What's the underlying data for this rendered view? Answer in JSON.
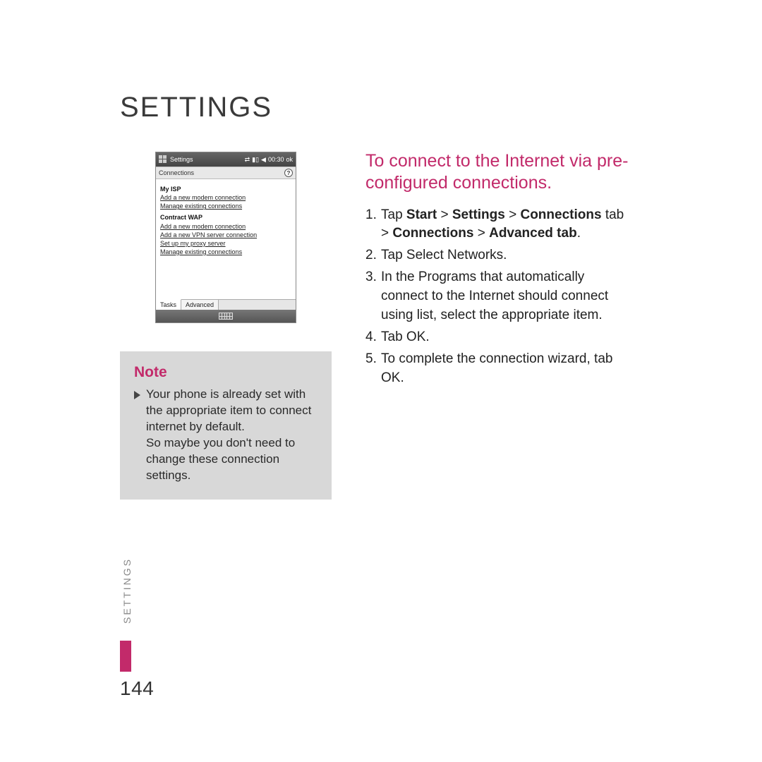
{
  "page_title": "SETTINGS",
  "side_label": "SETTINGS",
  "page_number": "144",
  "screenshot": {
    "titlebar_label": "Settings",
    "titlebar_time": "00:30",
    "titlebar_ok": "ok",
    "subbar_label": "Connections",
    "help_glyph": "?",
    "group1": "My ISP",
    "group1_link1": "Add a new modem connection",
    "group1_link2": "Manage existing connections",
    "group2": "Contract WAP",
    "group2_link1": "Add a new modem connection",
    "group2_link2": "Add a new VPN server connection",
    "group2_link3": "Set up my proxy server",
    "group2_link4": "Manage existing connections",
    "tab1": "Tasks",
    "tab2": "Advanced"
  },
  "note": {
    "title": "Note",
    "body": "Your phone is already set with the appropriate item to connect internet by default.\nSo maybe you don't need to change these connection settings."
  },
  "section_title": "To connect to the Internet via pre-configured connections.",
  "steps": {
    "s1_pre": "Tap ",
    "s1_b1": "Start",
    "s1_gt1": " > ",
    "s1_b2": "Settings",
    "s1_gt2": " > ",
    "s1_b3": "Connections",
    "s1_mid": " tab  > ",
    "s1_b4": "Connections",
    "s1_gt3": " > ",
    "s1_b5": "Advanced tab",
    "s1_end": ".",
    "s2": "Tap Select Networks.",
    "s3": "In the Programs that automatically connect to the Internet should connect using list, select the appropriate item.",
    "s4": "Tab OK.",
    "s5": "To complete the connection wizard, tab OK."
  }
}
